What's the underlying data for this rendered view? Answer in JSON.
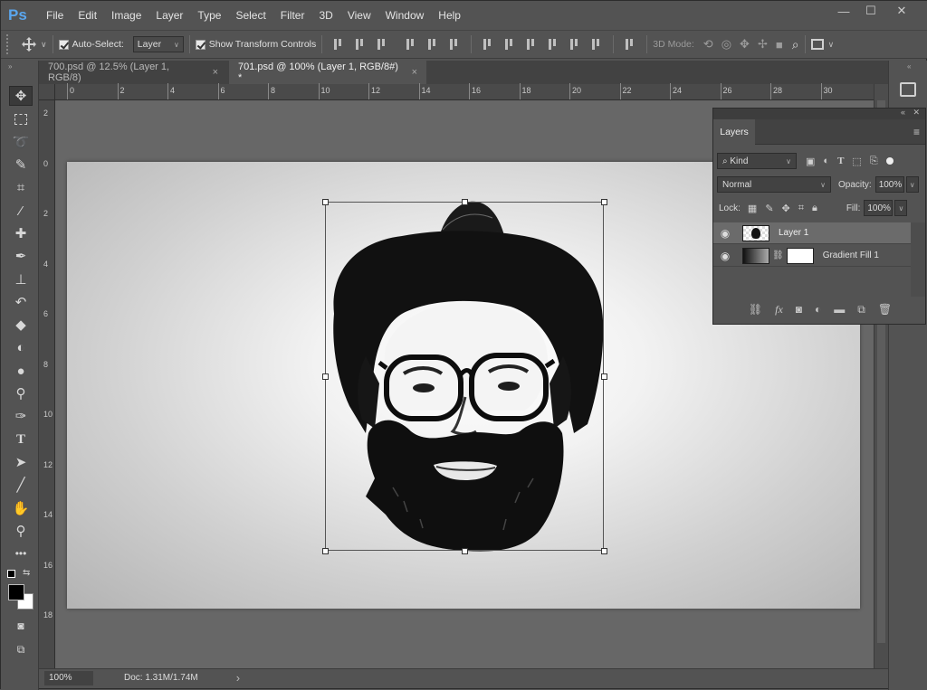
{
  "app": {
    "logo": "Ps"
  },
  "menu": [
    "File",
    "Edit",
    "Image",
    "Layer",
    "Type",
    "Select",
    "Filter",
    "3D",
    "View",
    "Window",
    "Help"
  ],
  "window_controls": {
    "minimize": "—",
    "maximize": "☐",
    "close": "✕"
  },
  "options": {
    "auto_select_label": "Auto-Select:",
    "auto_select_value": "Layer",
    "show_transform_label": "Show Transform Controls",
    "mode_3d_label": "3D Mode:"
  },
  "tabs": [
    {
      "label": "700.psd @ 12.5% (Layer 1, RGB/8)",
      "close": "×"
    },
    {
      "label": "701.psd @ 100% (Layer 1, RGB/8#) *",
      "close": "×"
    }
  ],
  "ruler_top": [
    "0",
    "2",
    "4",
    "6",
    "8",
    "10",
    "12",
    "14",
    "16",
    "18",
    "20",
    "22",
    "24",
    "26",
    "28",
    "30"
  ],
  "ruler_left": [
    "2",
    "0",
    "2",
    "4",
    "6",
    "8",
    "10",
    "12",
    "14",
    "16",
    "18"
  ],
  "status": {
    "zoom": "100%",
    "doc": "Doc: 1.31M/1.74M",
    "arrow": "›"
  },
  "layers_panel": {
    "tab": "Layers",
    "filter_kind": "Kind",
    "blend_mode": "Normal",
    "opacity_label": "Opacity:",
    "opacity_value": "100%",
    "lock_label": "Lock:",
    "fill_label": "Fill:",
    "fill_value": "100%",
    "layers": [
      {
        "name": "Layer 1"
      },
      {
        "name": "Gradient Fill 1"
      }
    ]
  }
}
